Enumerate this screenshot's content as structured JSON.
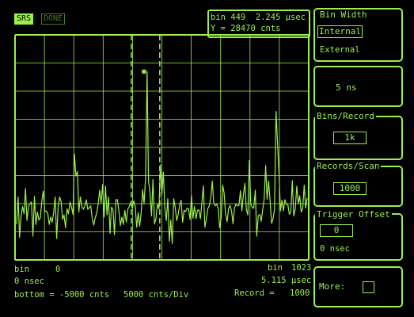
{
  "header": {
    "srs_badge": "SRS",
    "done_badge": "DONE",
    "cursor_bin": "bin 449",
    "cursor_time": "2.245 µsec",
    "cursor_y": "Y = 28470 cnts"
  },
  "footer": {
    "left_bin_label": "bin",
    "left_bin_value": "0",
    "left_time": "0 nsec",
    "right_bin_label": "bin",
    "right_bin_value": "1023",
    "right_time": "5.115 µsec",
    "bottom_text": "bottom = -5000 cnts",
    "scale_text": "5000 cnts/Div",
    "record_label": "Record =",
    "record_value": "1000"
  },
  "menu": {
    "bin_width": {
      "title": "Bin Width",
      "selected": "Internal",
      "other": "External"
    },
    "bin_width_value": "5 ns",
    "bins_per_record": {
      "title": "Bins/Record",
      "value": "1k"
    },
    "records_per_scan": {
      "title": "Records/Scan",
      "value": "1000"
    },
    "trigger_offset": {
      "title": "Trigger Offset",
      "value": "0",
      "unit": "0 nsec"
    },
    "more": {
      "label": "More:"
    }
  },
  "colors": {
    "phosphor": "#9cf04c",
    "background": "#000000"
  },
  "chart_data": {
    "type": "line",
    "x_range_bins": [
      0,
      1023
    ],
    "x_range_time_usec": [
      0,
      5.115
    ],
    "y_bottom_cnts": -5000,
    "y_scale_cnts_per_div": 5000,
    "cursor": {
      "bin": 449,
      "time_usec": 2.245,
      "y_cnts": 28470
    },
    "grid": true,
    "series": [
      {
        "values": [
          1400,
          6200,
          -1000,
          2800,
          4500,
          3200,
          7700,
          2000,
          4500,
          5000,
          5300,
          -800,
          6300,
          1300,
          3500,
          2100,
          2500,
          5400,
          7200,
          3600,
          3700,
          3300,
          1300,
          2600,
          1700,
          3400,
          6200,
          -1200,
          4300,
          6200,
          5400,
          2200,
          3000,
          700,
          4100,
          3200,
          5300,
          4400,
          3100,
          13800,
          9900,
          10700,
          3500,
          6200,
          4500,
          4000,
          4600,
          5700,
          4000,
          4300,
          4600,
          2400,
          1200,
          2400,
          3300,
          4900,
          7400,
          5100,
          8400,
          2600,
          8100,
          3000,
          6200,
          -300,
          4400,
          4000,
          -500,
          5700,
          5700,
          3700,
          1100,
          2600,
          1300,
          3800,
          1700,
          4000,
          4500,
          5200,
          4200,
          5500,
          4500,
          800,
          3400,
          1000,
          3400,
          7500,
          5000,
          9600,
          28500,
          9000,
          7000,
          2800,
          9300,
          1400,
          2300,
          4900,
          4100,
          11900,
          6600,
          10600,
          4300,
          2000,
          5900,
          -1700,
          2100,
          -2100,
          5900,
          4300,
          2000,
          3100,
          4800,
          5600,
          1700,
          3800,
          3600,
          4200,
          4100,
          2200,
          6400,
          2400,
          4500,
          2300,
          3800,
          3900,
          2300,
          5300,
          8200,
          800,
          2300,
          4100,
          4600,
          6000,
          9000,
          5200,
          4600,
          4900,
          4100,
          700,
          2400,
          8300,
          6900,
          3100,
          1800,
          4100,
          4700,
          3700,
          1400,
          4300,
          4900,
          4600,
          4700,
          7300,
          3700,
          6700,
          8600,
          4000,
          3000,
          12700,
          4900,
          4300,
          4200,
          7400,
          -800,
          2800,
          3100,
          1900,
          3900,
          5800,
          11800,
          5800,
          9000,
          5500,
          1500,
          2300,
          4000,
          21400,
          15800,
          10600,
          3700,
          5600,
          3700,
          5700,
          4900,
          4800,
          3100,
          3600,
          9100,
          2800,
          4100,
          8100,
          5000,
          6400,
          3500,
          4200,
          8300,
          4200,
          6000
        ]
      }
    ]
  }
}
